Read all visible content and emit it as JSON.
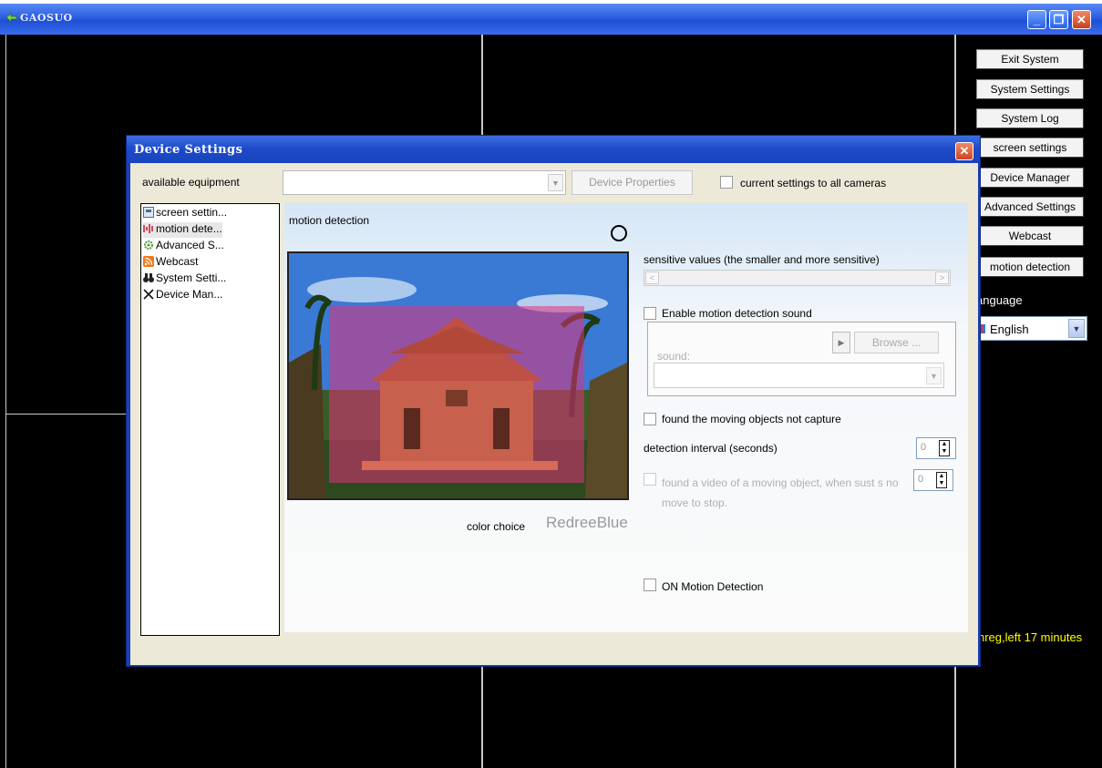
{
  "app": {
    "title": "GAOSUO",
    "minimize": "_",
    "restore": "❐",
    "close": "✕"
  },
  "side_panel": {
    "buttons": [
      "Exit System",
      "System Settings",
      "System Log",
      "screen settings",
      "Device Manager",
      "Advanced Settings",
      "Webcast",
      "motion detection"
    ],
    "language_label": "anguage",
    "language_value": "English",
    "status_text": "nreg,left 17 minutes"
  },
  "dialog": {
    "title": "Device Settings",
    "close": "✕",
    "available_label": "available equipment",
    "available_value": "",
    "device_properties_button": "Device Properties",
    "apply_all_label": "current settings to all cameras",
    "tree": [
      {
        "label": "screen settin...",
        "icon": "screen-icon"
      },
      {
        "label": "motion dete...",
        "icon": "motion-icon"
      },
      {
        "label": "Advanced S...",
        "icon": "advanced-icon"
      },
      {
        "label": "Webcast",
        "icon": "webcast-icon"
      },
      {
        "label": "System Setti...",
        "icon": "binoculars-icon"
      },
      {
        "label": "Device Man...",
        "icon": "cross-icon"
      }
    ],
    "content": {
      "title": "motion detection",
      "color_choice_label": "color choice",
      "color_choice_value": "RedreeBlue",
      "sensitive_label": "sensitive values (the smaller and more sensitive)",
      "sound_enable_label": "Enable motion detection sound",
      "sound_field_label": "sound:",
      "browse_button": "Browse ...",
      "sound_value": "",
      "no_capture_label": "found the moving objects not capture",
      "interval_label": "detection interval (seconds)",
      "interval_value": "0",
      "stop_label": "found a video of a moving object, when sust s no move to stop.",
      "stop_value": "0",
      "motion_on_label": "ON Motion Detection"
    }
  },
  "colors": {
    "titlebar": "#2b5ee0",
    "overlay": "#e0327a",
    "status": "#ffff00"
  }
}
